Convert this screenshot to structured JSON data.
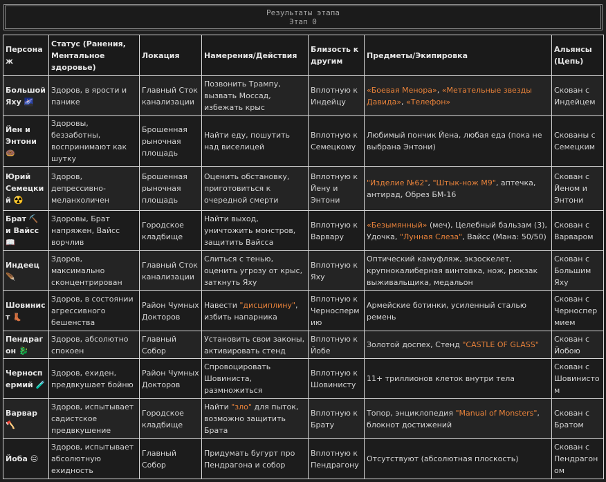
{
  "header": {
    "title": "Результаты этапа",
    "subtitle": "Этап 0"
  },
  "columns": [
    "Персонаж",
    "Статус (Ранения, Ментальное здоровье)",
    "Локация",
    "Намерения/Действия",
    "Близость к другим",
    "Предметы/Экипировка",
    "Альянсы (Цепь)"
  ],
  "rows": [
    {
      "name": "Большой Яху 🌌",
      "status": "Здоров, в ярости и панике",
      "location": "Главный Сток канализации",
      "intent": [
        {
          "t": "Позвонить Трампу, вызвать Моссад, избежать крыс"
        }
      ],
      "proximity": "Вплотную к Индейцу",
      "items": [
        {
          "t": "«Боевая Менора»",
          "h": true
        },
        {
          "t": ", "
        },
        {
          "t": "«Метательные звезды Давида»",
          "h": true
        },
        {
          "t": ", "
        },
        {
          "t": "«Телефон»",
          "h": true
        }
      ],
      "alliance": "Скован с Индейцем"
    },
    {
      "name": "Йен и Энтони 🍩",
      "status": "Здоровы, беззаботны, воспринимают как шутку",
      "location": "Брошенная рыночная площадь",
      "intent": [
        {
          "t": "Найти еду, пошутить над виселицей"
        }
      ],
      "proximity": "Вплотную к Семецкому",
      "items": [
        {
          "t": "Любимый пончик Йена, любая еда (пока не выбрана Энтони)"
        }
      ],
      "alliance": "Скованы с Семецким"
    },
    {
      "name": "Юрий Семецкий ☢️",
      "status": "Здоров, депрессивно-меланхоличен",
      "location": "Брошенная рыночная площадь",
      "intent": [
        {
          "t": "Оценить обстановку, приготовиться к очередной смерти"
        }
      ],
      "proximity": "Вплотную к Йену и Энтони",
      "items": [
        {
          "t": "\"Изделие №62\"",
          "h": true
        },
        {
          "t": ", "
        },
        {
          "t": "\"Штык-нож М9\"",
          "h": true
        },
        {
          "t": ", аптечка, антирад, Обрез БМ-16"
        }
      ],
      "alliance": "Скован с Йеном и Энтони"
    },
    {
      "name": "Брат ⛏️ и Вайсс 📖",
      "status": "Здоровы, Брат напряжен, Вайсс ворчлив",
      "location": "Городское кладбище",
      "intent": [
        {
          "t": "Найти выход, уничтожить монстров, защитить Вайсса"
        }
      ],
      "proximity": "Вплотную к Варвару",
      "items": [
        {
          "t": "«Безымянный»",
          "h": true
        },
        {
          "t": " (меч), Целебный бальзам (3), Удочка, "
        },
        {
          "t": "\"Лунная Слеза\"",
          "h": true
        },
        {
          "t": ", Вайсс (Мана: 50/50)"
        }
      ],
      "alliance": "Скован с Варваром"
    },
    {
      "name": "Индеец 🪶",
      "status": "Здоров, максимально сконцентрирован",
      "location": "Главный Сток канализации",
      "intent": [
        {
          "t": "Слиться с тенью, оценить угрозу от крыс, заткнуть Яху"
        }
      ],
      "proximity": "Вплотную к Яху",
      "items": [
        {
          "t": "Оптический камуфляж, экзоскелет, крупнокалиберная винтовка, нож, рюкзак выживальщика, медальон"
        }
      ],
      "alliance": "Скован с Большим Яху"
    },
    {
      "name": "Шовинист 👢",
      "status": "Здоров, в состоянии агрессивного бешенства",
      "location": "Район Чумных Докторов",
      "intent": [
        {
          "t": "Навести "
        },
        {
          "t": "\"дисциплину\"",
          "h": true
        },
        {
          "t": ", избить напарника"
        }
      ],
      "proximity": "Вплотную к Черноспермию",
      "items": [
        {
          "t": "Армейские ботинки, усиленный сталью ремень"
        }
      ],
      "alliance": "Скован с Черноспермием"
    },
    {
      "name": "Пендрагон 🐉",
      "status": "Здоров, абсолютно спокоен",
      "location": "Главный Собор",
      "intent": [
        {
          "t": "Установить свои законы, активировать стенд"
        }
      ],
      "proximity": "Вплотную к Йобе",
      "items": [
        {
          "t": "Золотой доспех, Стенд "
        },
        {
          "t": "\"CASTLE OF GLASS\"",
          "h": true
        }
      ],
      "alliance": "Скован с Йобою"
    },
    {
      "name": "Черноспермий 🧪",
      "status": "Здоров, ехиден, предвкушает бойню",
      "location": "Район Чумных Докторов",
      "intent": [
        {
          "t": "Спровоцировать Шовиниста, размножиться"
        }
      ],
      "proximity": "Вплотную к Шовинисту",
      "items": [
        {
          "t": "11+ триллионов клеток внутри тела"
        }
      ],
      "alliance": "Скован с Шовинистом"
    },
    {
      "name": "Варвар 🪓",
      "status": "Здоров, испытывает садистское предвкушение",
      "location": "Городское кладбище",
      "intent": [
        {
          "t": "Найти "
        },
        {
          "t": "\"зло\"",
          "h": true
        },
        {
          "t": " для пыток, возможно защитить Брата"
        }
      ],
      "proximity": "Вплотную к Брату",
      "items": [
        {
          "t": "Топор, энциклопедия "
        },
        {
          "t": "\"Manual of Monsters\"",
          "h": true
        },
        {
          "t": ", блокнот достижений"
        }
      ],
      "alliance": "Скован с Братом"
    },
    {
      "name": "Йоба 😐",
      "status": "Здоров, испытывает абсолютную ехидность",
      "location": "Главный Собор",
      "intent": [
        {
          "t": "Придумать бугурт про Пендрагона и собор"
        }
      ],
      "proximity": "Вплотную к Пендрагону",
      "items": [
        {
          "t": "Отсутствуют (абсолютная плоскость)"
        }
      ],
      "alliance": "Скован с Пендрагоном"
    }
  ]
}
